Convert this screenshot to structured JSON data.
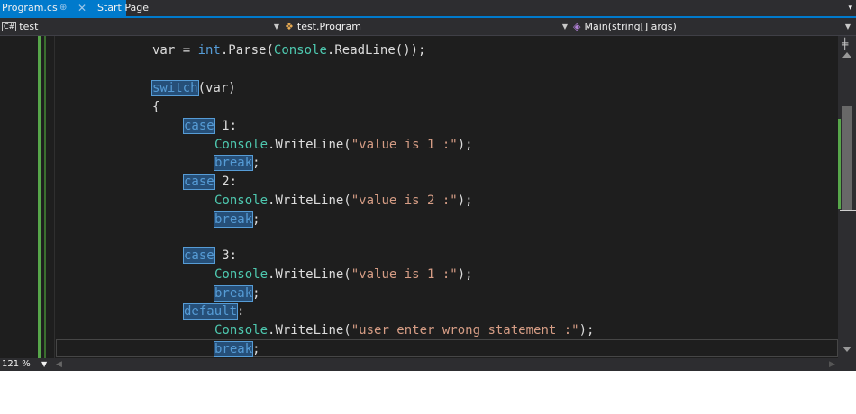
{
  "tabs": {
    "active_label": "Program.cs",
    "pin_glyph": "⊕",
    "close_glyph": "✕",
    "second_label": "Start Page",
    "overflow_glyph": "▾"
  },
  "navbar": {
    "project_badge": "C#",
    "project": "test",
    "class_icon": "class-icon",
    "class": "test.Program",
    "member_icon": "method-icon",
    "member": "Main(string[] args)"
  },
  "code_lines": [
    "var = int.Parse(Console.ReadLine());",
    "",
    "switch(var)",
    "{",
    "case 1:",
    "Console.WriteLine(\"value is 1 :\");",
    "break;",
    "case 2:",
    "Console.WriteLine(\"value is 2 :\");",
    "break;",
    "",
    "case 3:",
    "Console.WriteLine(\"value is 1 :\");",
    "break;",
    "default:",
    "Console.WriteLine(\"user enter wrong statement :\");",
    "break;"
  ],
  "status": {
    "zoom": "121 %"
  },
  "colors": {
    "editor_bg": "#1e1e1e",
    "keyword": "#569cd6",
    "type": "#4ec9b0",
    "string": "#d69d85",
    "highlight_bg": "#264f78",
    "accent": "#007acc",
    "change_marker": "#57a64a"
  }
}
